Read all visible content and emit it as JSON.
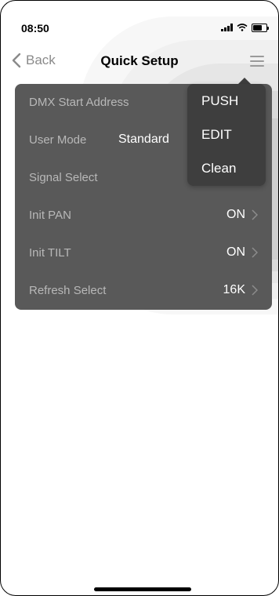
{
  "status_bar": {
    "time": "08:50"
  },
  "nav": {
    "back_label": "Back",
    "title": "Quick Setup"
  },
  "settings": {
    "rows": [
      {
        "label": "DMX Start Address",
        "value": ""
      },
      {
        "label": "User Mode",
        "value": "Standard"
      },
      {
        "label": "Signal Select",
        "value": ""
      },
      {
        "label": "Init PAN",
        "value": "ON"
      },
      {
        "label": "Init TILT",
        "value": "ON"
      },
      {
        "label": "Refresh Select",
        "value": "16K"
      }
    ]
  },
  "menu": {
    "items": [
      {
        "label": "PUSH"
      },
      {
        "label": "EDIT"
      },
      {
        "label": "Clean"
      }
    ]
  },
  "icons": {
    "back": "chevron-left-icon",
    "menu": "hamburger-menu-icon",
    "row_chevron": "chevron-right-icon",
    "signal": "signal-bars-icon",
    "wifi": "wifi-icon",
    "battery": "battery-icon"
  },
  "colors": {
    "panel": "#595959",
    "dropdown": "#3e3e3e",
    "label": "#b8b8b8",
    "value": "#ffffff"
  }
}
